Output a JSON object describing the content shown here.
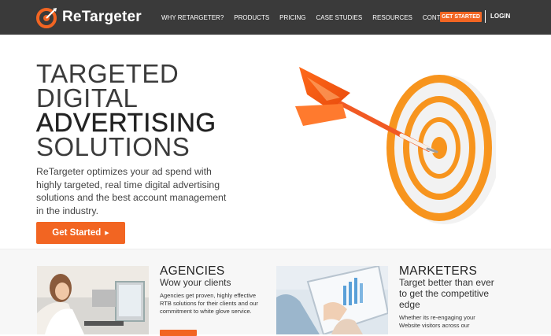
{
  "brand": {
    "name": "ReTargeter",
    "accent": "#f26522",
    "header_bg": "#3a3a3a"
  },
  "nav": {
    "items": [
      {
        "label": "WHY RETARGETER?"
      },
      {
        "label": "PRODUCTS"
      },
      {
        "label": "PRICING"
      },
      {
        "label": "CASE STUDIES"
      },
      {
        "label": "RESOURCES"
      },
      {
        "label": "CONTACT"
      }
    ],
    "cta_label": "GET STARTED",
    "login_label": "LOGIN"
  },
  "hero": {
    "headline": [
      "TARGETED",
      "DIGITAL",
      "ADVERTISING",
      "SOLUTIONS"
    ],
    "subtext": "ReTargeter optimizes your ad spend with highly targeted, real time digital advertising solutions and the best account management in the industry.",
    "button_label": "Get Started",
    "button_icon": "triangle-right-icon"
  },
  "features": [
    {
      "title": "AGENCIES",
      "subtitle": "Wow your clients",
      "body": "Agencies get proven, highly effective RTB solutions for their clients and our commitment to white glove service."
    },
    {
      "title": "MARKETERS",
      "subtitle": "Target better than ever to get the competitive edge",
      "body": "Whether its re-engaging your Website visitors across our"
    }
  ]
}
